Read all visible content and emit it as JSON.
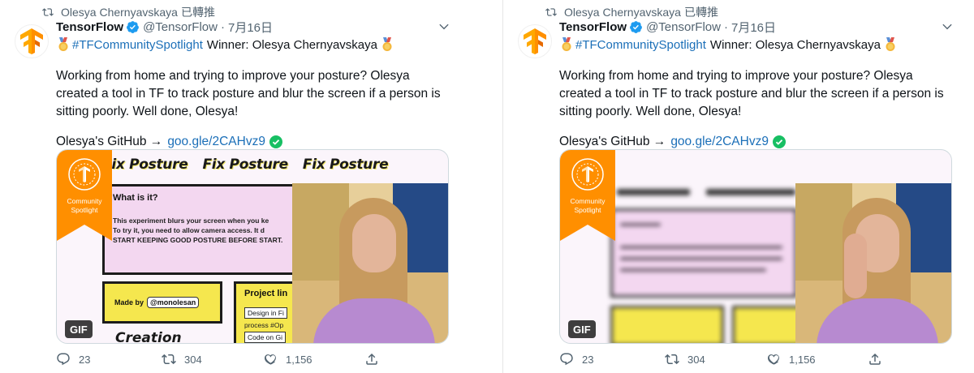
{
  "retweeted_by": "Olesya Chernyavskaya",
  "retweet_suffix": "已轉推",
  "tweets": [
    {
      "author_name": "TensorFlow",
      "handle": "@TensorFlow",
      "separator": "·",
      "date": "7月16日",
      "hashtag": "#TFCommunitySpotlight",
      "headline_rest": "Winner: Olesya Chernyavskaya",
      "body": "Working from home and trying to improve your posture? Olesya created a tool in TF to track posture and blur the screen if a person is sitting poorly. Well done, Olesya!",
      "github_label": "Olesya's GitHub →",
      "github_link": "goo.gle/2CAHvz9",
      "media": {
        "strip_titles": [
          "Fix Posture",
          "Fix Posture",
          "Fix Posture"
        ],
        "badge_line1": "Community",
        "badge_line2": "Spotlight",
        "what_title": "What is it?",
        "what_lines": [
          "This experiment blurs your screen when you ke",
          "To try it, you need to allow camera access. It d",
          "START KEEPING GOOD POSTURE BEFORE START."
        ],
        "made_by_label": "Made by",
        "made_by_handle": "@monolesan",
        "project_title": "Project lin",
        "project_link": "Design in Fi",
        "project_sub": "process #Op",
        "project_sub2": "Code on Gi",
        "creation": "Creation",
        "gif_label": "GIF"
      },
      "stats": {
        "replies": "23",
        "retweets": "304",
        "likes": "1,156"
      }
    },
    {
      "author_name": "TensorFlow",
      "handle": "@TensorFlow",
      "separator": "·",
      "date": "7月16日",
      "hashtag": "#TFCommunitySpotlight",
      "headline_rest": "Winner: Olesya Chernyavskaya",
      "body": "Working from home and trying to improve your posture? Olesya created a tool in TF to track posture and blur the screen if a person is sitting poorly. Well done, Olesya!",
      "github_label": "Olesya's GitHub →",
      "github_link": "goo.gle/2CAHvz9",
      "media": {
        "badge_line1": "Community",
        "badge_line2": "Spotlight",
        "gif_label": "GIF"
      },
      "stats": {
        "replies": "23",
        "retweets": "304",
        "likes": "1,156"
      }
    }
  ],
  "colors": {
    "link": "#1b6fb8",
    "verified": "#1d9bf0",
    "check": "#17bf63",
    "tf_orange": "#ff8f00",
    "muted": "#536471"
  },
  "icons": [
    "retweet-icon",
    "tensorflow-logo-icon",
    "verified-badge-icon",
    "chevron-down-icon",
    "medal-icon",
    "checkmark-icon",
    "reply-icon",
    "like-icon",
    "share-icon"
  ]
}
